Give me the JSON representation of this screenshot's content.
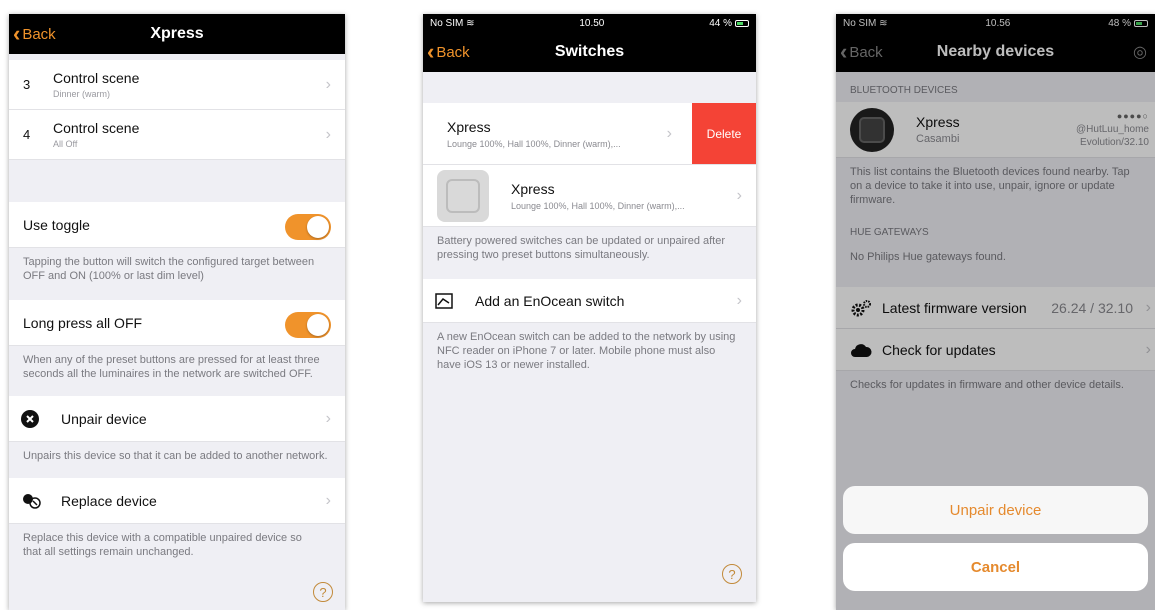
{
  "colors": {
    "accent": "#f0932b",
    "delete": "#f44336",
    "navbar": "#000000"
  },
  "screen1": {
    "back_label": "Back",
    "title": "Xpress",
    "scenes": [
      {
        "num": "3",
        "title": "Control scene",
        "subtitle": "Dinner (warm)"
      },
      {
        "num": "4",
        "title": "Control scene",
        "subtitle": "All Off"
      }
    ],
    "use_toggle": {
      "label": "Use toggle",
      "on": true,
      "note": "Tapping the button will switch the configured target between OFF and ON (100% or last dim level)"
    },
    "long_press": {
      "label": "Long press all OFF",
      "on": true,
      "note": "When any of the preset buttons are pressed for at least three seconds all the luminaires in the network are switched OFF."
    },
    "unpair": {
      "label": "Unpair device",
      "icon": "close-circle-icon",
      "note": "Unpairs this device so that it can be added to another network."
    },
    "replace": {
      "label": "Replace device",
      "icon": "replace-icon",
      "note": "Replace this device with a compatible unpaired device so that all settings remain unchanged."
    },
    "help_icon": "?"
  },
  "screen2": {
    "status": {
      "carrier": "No SIM",
      "time": "10.50",
      "battery": "44 %"
    },
    "back_label": "Back",
    "title": "Switches",
    "switches": [
      {
        "title": "Xpress",
        "subtitle": "Lounge 100%, Hall 100%, Dinner (warm),..."
      },
      {
        "title": "Xpress",
        "subtitle": "Lounge 100%, Hall 100%, Dinner (warm),..."
      }
    ],
    "delete_label": "Delete",
    "battery_note": "Battery powered switches can be updated or unpaired after pressing two preset buttons simultaneously.",
    "add_switch_label": "Add an EnOcean switch",
    "add_note": "A new EnOcean switch can be added to the network by using NFC reader on iPhone 7 or later. Mobile phone must also have iOS 13 or newer installed.",
    "help_icon": "?"
  },
  "screen3": {
    "status": {
      "carrier": "No SIM",
      "time": "10.56",
      "battery": "48 %"
    },
    "back_label": "Back",
    "title": "Nearby devices",
    "bt_header": "BLUETOOTH DEVICES",
    "device": {
      "name": "Xpress",
      "maker": "Casambi",
      "signal": "●●●●○",
      "network": "@HutLuu_home",
      "version": "Evolution/32.10"
    },
    "bt_note": "This list contains the Bluetooth devices found nearby. Tap on a device to take it into use, unpair, ignore or update firmware.",
    "hue_header": "HUE GATEWAYS",
    "hue_note": "No Philips Hue gateways found.",
    "firmware": {
      "label": "Latest firmware version",
      "value": "26.24 / 32.10"
    },
    "check": {
      "label": "Check for updates"
    },
    "check_note": "Checks for updates in firmware and other device details.",
    "sheet": {
      "unpair": "Unpair device",
      "cancel": "Cancel"
    }
  }
}
